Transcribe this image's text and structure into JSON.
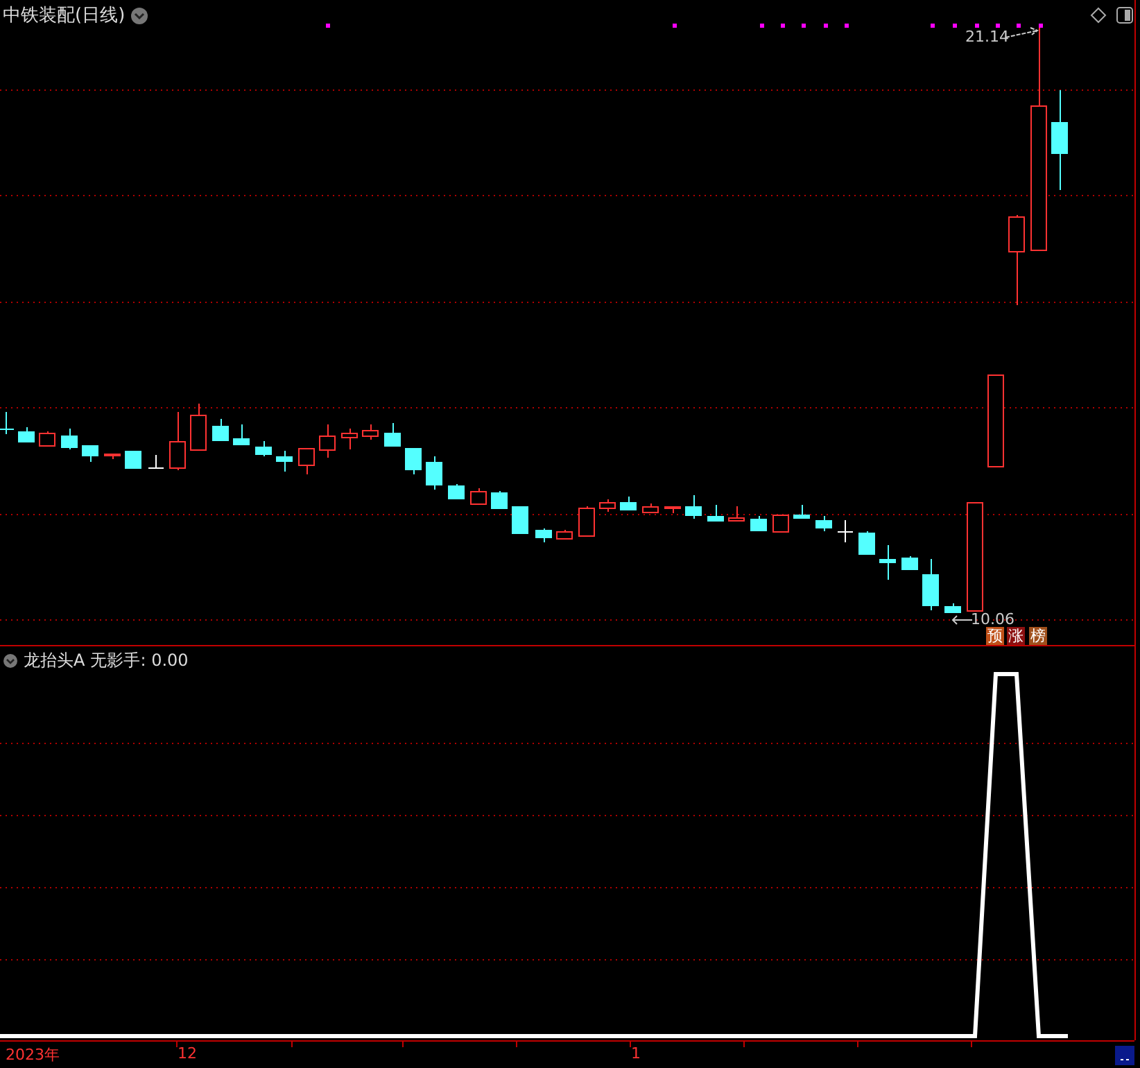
{
  "chart": {
    "title": "中铁装配(日线)",
    "high_label": "21.14",
    "low_label": "10.06",
    "tags": [
      {
        "text": "预",
        "color": "#c05018"
      },
      {
        "text": "涨",
        "color": "#8c1010"
      },
      {
        "text": "榜",
        "color": "#a0501c"
      }
    ]
  },
  "indicator": {
    "name": "龙抬头A",
    "reading": "无影手: 0.00"
  },
  "time_axis": {
    "labels": [
      "2023年",
      "12",
      "1"
    ]
  }
}
